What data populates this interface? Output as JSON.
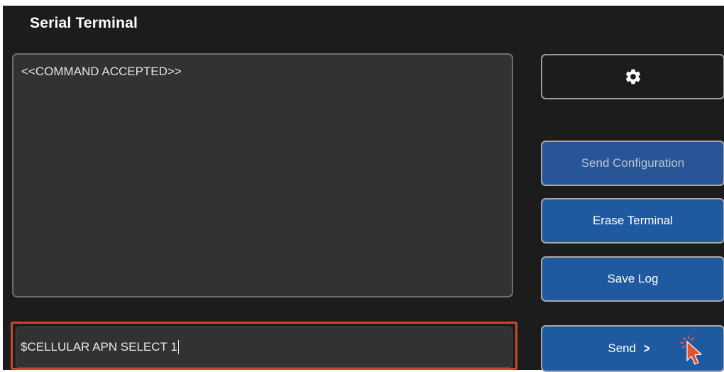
{
  "window": {
    "title": "Serial Terminal"
  },
  "terminal": {
    "output_text": "<<COMMAND ACCEPTED>>",
    "input_value": "$CELLULAR APN SELECT 1"
  },
  "buttons": {
    "settings_icon": "gear-icon",
    "send_configuration": "Send Configuration",
    "erase_terminal": "Erase Terminal",
    "save_log": "Save Log",
    "send": "Send",
    "send_chevron": ">"
  },
  "colors": {
    "background": "#1c1c1c",
    "panel": "#323232",
    "button_blue": "#1f5aa0",
    "highlight": "#c64a2a"
  }
}
